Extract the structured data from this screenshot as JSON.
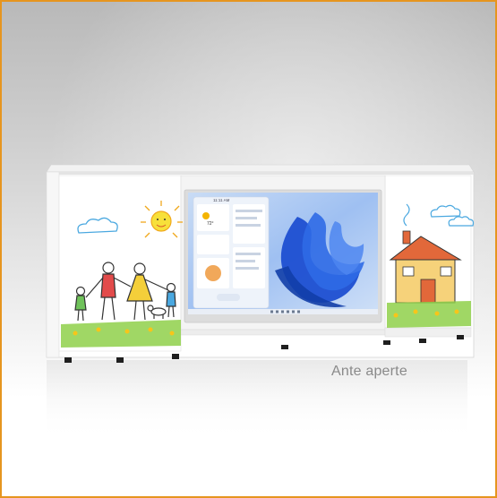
{
  "caption": {
    "text": "Ante aperte"
  },
  "product": {
    "screen": {
      "clock": "11:11 AM",
      "weather_temp": "72°"
    }
  },
  "colors": {
    "border": "#e6951f",
    "cabinet": "#ffffff",
    "screen_bezel": "#d9d9d9",
    "wallpaper_deep": "#1d4fd1",
    "wallpaper_light": "#9fc0f2",
    "grass": "#8fd04a",
    "sun": "#f7c51a",
    "house_wall": "#f6d27a",
    "roof": "#e2683a"
  }
}
